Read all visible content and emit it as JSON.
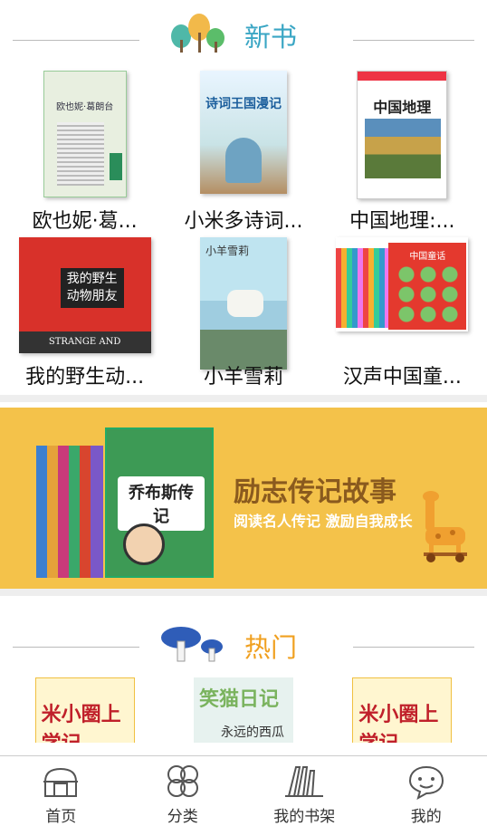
{
  "new_section": {
    "title": "新书"
  },
  "new_books": [
    {
      "title": "欧也妮·葛...",
      "cover_text": "欧也妮·葛朗台"
    },
    {
      "title": "小米多诗词...",
      "cover_text": "诗词王国漫记"
    },
    {
      "title": "中国地理:...",
      "cover_text": "中国地理"
    },
    {
      "title": "我的野生动...",
      "cover_text": "我的野生动物朋友",
      "cover_sub": "STRANGE AND WONDERFUL"
    },
    {
      "title": "小羊雪莉",
      "cover_text": "小羊雪莉"
    },
    {
      "title": "汉声中国童...",
      "cover_text": "中国童话"
    }
  ],
  "banner": {
    "title": "励志传记故事",
    "subtitle": "阅读名人传记 激励自我成长",
    "book_text": "乔布斯传记",
    "bg_color": "#f4c24a"
  },
  "hot_section": {
    "title": "热门"
  },
  "hot_books": [
    {
      "cover_text": "米小圈上学记"
    },
    {
      "cover_text": "笑猫日记",
      "cover_sub": "永远的西瓜小丑"
    },
    {
      "cover_text": "米小圈上学记"
    }
  ],
  "tabs": [
    {
      "label": "首页",
      "icon": "home-icon"
    },
    {
      "label": "分类",
      "icon": "category-icon"
    },
    {
      "label": "我的书架",
      "icon": "bookshelf-icon"
    },
    {
      "label": "我的",
      "icon": "profile-icon"
    }
  ]
}
